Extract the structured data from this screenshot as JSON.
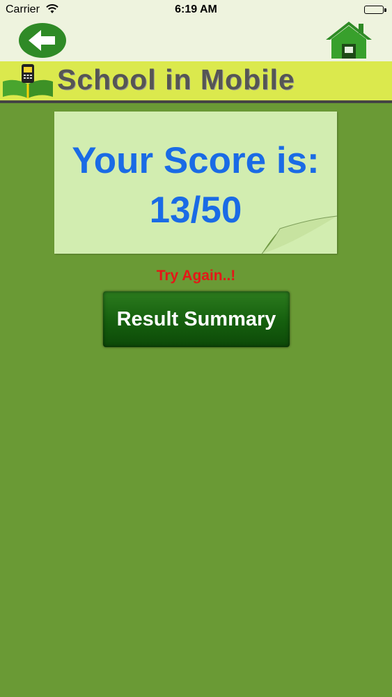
{
  "status_bar": {
    "carrier": "Carrier",
    "time": "6:19 AM"
  },
  "nav": {
    "back_icon": "arrow-left-icon",
    "home_icon": "house-icon"
  },
  "banner": {
    "title": "School in Mobile",
    "logo_icon": "book-phone-logo-icon"
  },
  "score": {
    "label": "Your Score is:",
    "value": "13/50"
  },
  "feedback": {
    "message": "Try Again..!"
  },
  "actions": {
    "result_summary": "Result Summary"
  },
  "colors": {
    "background": "#6a9a35",
    "card": "#d2edb0",
    "score_text": "#1a6be5",
    "message": "#e41717",
    "button": "#155f0e"
  }
}
